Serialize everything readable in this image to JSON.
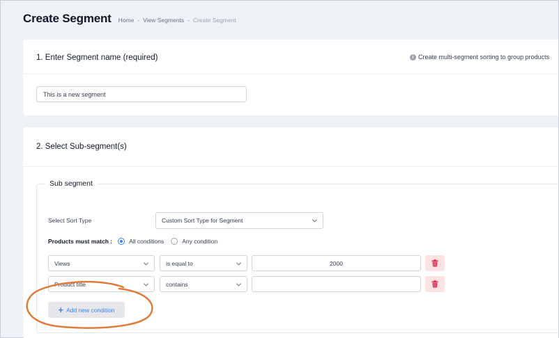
{
  "header": {
    "title": "Create Segment",
    "breadcrumb": [
      "Home",
      "-",
      "View Segments",
      "-",
      "Create Segment"
    ]
  },
  "section1": {
    "title": "1. Enter Segment name (required)",
    "info_text": "Create multi-segment sorting to group products",
    "name_value": "This is a new segment"
  },
  "section2": {
    "title": "2. Select Sub-segment(s)",
    "subsegment": {
      "legend": "Sub segment",
      "sort_type_label": "Select Sort Type",
      "sort_type_value": "Custom Sort Type for Segment",
      "match_label": "Products must match :",
      "match_options": [
        "All conditions",
        "Any condition"
      ],
      "match_selected": "All conditions",
      "conditions": [
        {
          "field": "Views",
          "operator": "is equal to",
          "value": "2000"
        },
        {
          "field": "Product title",
          "operator": "contains",
          "value": ""
        }
      ],
      "add_condition_label": "Add new condition"
    }
  },
  "colors": {
    "accent": "#3b82f6",
    "delete_bg": "#fde2e4",
    "delete_icon": "#e11d48",
    "annotation": "#e07a3a"
  }
}
